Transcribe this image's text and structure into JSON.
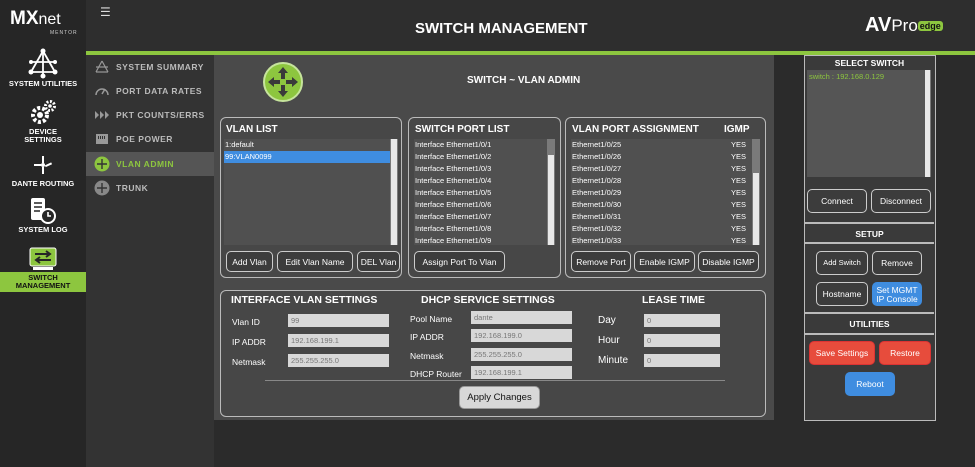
{
  "brand": {
    "name_a": "MX",
    "name_b": "net",
    "sub": "MENTOR"
  },
  "rail": [
    {
      "label": "SYSTEM UTILITIES"
    },
    {
      "label": "DEVICE SETTINGS"
    },
    {
      "label": "DANTE ROUTING"
    },
    {
      "label": "SYSTEM LOG"
    },
    {
      "label": "SWITCH MANAGEMENT"
    }
  ],
  "header": {
    "title": "SWITCH MANAGEMENT",
    "logo_a": "AV",
    "logo_b": "Pro",
    "logo_c": "edge"
  },
  "subnav": [
    {
      "label": "SYSTEM SUMMARY"
    },
    {
      "label": "PORT DATA RATES"
    },
    {
      "label": "PKT COUNTS/ERRS"
    },
    {
      "label": "POE POWER"
    },
    {
      "label": "VLAN ADMIN"
    },
    {
      "label": "TRUNK"
    }
  ],
  "main": {
    "title": "SWITCH ~ VLAN ADMIN"
  },
  "vlan_list": {
    "title": "VLAN LIST",
    "items": [
      "1:default",
      "99:VLAN0099"
    ],
    "buttons": {
      "add": "Add Vlan",
      "edit": "Edit Vlan Name",
      "del": "DEL Vlan"
    }
  },
  "switch_port_list": {
    "title": "SWITCH PORT LIST",
    "items": [
      "Interface Ethernet1/0/1",
      "Interface Ethernet1/0/2",
      "Interface Ethernet1/0/3",
      "Interface Ethernet1/0/4",
      "Interface Ethernet1/0/5",
      "Interface Ethernet1/0/6",
      "Interface Ethernet1/0/7",
      "Interface Ethernet1/0/8",
      "Interface Ethernet1/0/9"
    ],
    "button": "Assign Port To Vlan"
  },
  "vlan_port_assignment": {
    "title": "VLAN PORT ASSIGNMENT",
    "igmp_header": "IGMP",
    "items": [
      {
        "port": "Ethernet1/0/25",
        "igmp": "YES"
      },
      {
        "port": "Ethernet1/0/26",
        "igmp": "YES"
      },
      {
        "port": "Ethernet1/0/27",
        "igmp": "YES"
      },
      {
        "port": "Ethernet1/0/28",
        "igmp": "YES"
      },
      {
        "port": "Ethernet1/0/29",
        "igmp": "YES"
      },
      {
        "port": "Ethernet1/0/30",
        "igmp": "YES"
      },
      {
        "port": "Ethernet1/0/31",
        "igmp": "YES"
      },
      {
        "port": "Ethernet1/0/32",
        "igmp": "YES"
      },
      {
        "port": "Ethernet1/0/33",
        "igmp": "YES"
      }
    ],
    "buttons": {
      "remove": "Remove Port",
      "enable": "Enable IGMP",
      "disable": "Disable IGMP"
    }
  },
  "interface_vlan": {
    "title": "INTERFACE VLAN SETTINGS",
    "vlan_id_label": "Vlan ID",
    "vlan_id": "99",
    "ip_label": "IP ADDR",
    "ip": "192.168.199.1",
    "mask_label": "Netmask",
    "mask": "255.255.255.0"
  },
  "dhcp": {
    "title": "DHCP SERVICE SETTINGS",
    "pool_label": "Pool Name",
    "pool": "dante",
    "ip_label": "IP ADDR",
    "ip": "192.168.199.0",
    "mask_label": "Netmask",
    "mask": "255.255.255.0",
    "router_label": "DHCP Router",
    "router": "192.168.199.1"
  },
  "lease": {
    "title": "LEASE TIME",
    "day_label": "Day",
    "day": "0",
    "hour_label": "Hour",
    "hour": "0",
    "minute_label": "Minute",
    "minute": "0"
  },
  "apply_button": "Apply Changes",
  "right_panel": {
    "select_title": "SELECT SWITCH",
    "switches": [
      "switch : 192.168.0.129"
    ],
    "connect": "Connect",
    "disconnect": "Disconnect",
    "setup_title": "SETUP",
    "add_switch": "Add Switch",
    "remove": "Remove",
    "hostname": "Hostname",
    "set_mgmt_a": "Set MGMT",
    "set_mgmt_b": "IP Console",
    "utilities_title": "UTILITIES",
    "save": "Save Settings",
    "restore": "Restore",
    "reboot": "Reboot"
  },
  "colors": {
    "accent": "#8dc63f",
    "select": "#3f8de0",
    "danger": "#e74c3c"
  }
}
